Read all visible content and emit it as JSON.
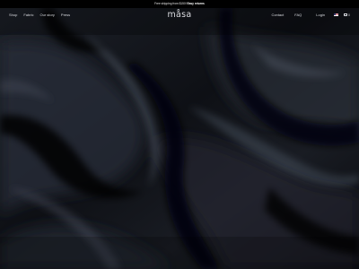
{
  "announcement": {
    "text": "Free shipping from $150! ",
    "link": "Easy returns"
  },
  "header": {
    "logo": "måsa",
    "nav_left": [
      "Shop",
      "Fabric",
      "Our story",
      "Press"
    ],
    "contact": "Contact",
    "faq": "FAQ",
    "login": "Login",
    "cart_count": "0"
  },
  "hero": {
    "image_description_icon": "black-satin-fabric-image"
  },
  "colors": {
    "background": "#0b0c10",
    "bar": "#000000",
    "text": "#d9dbe0"
  }
}
